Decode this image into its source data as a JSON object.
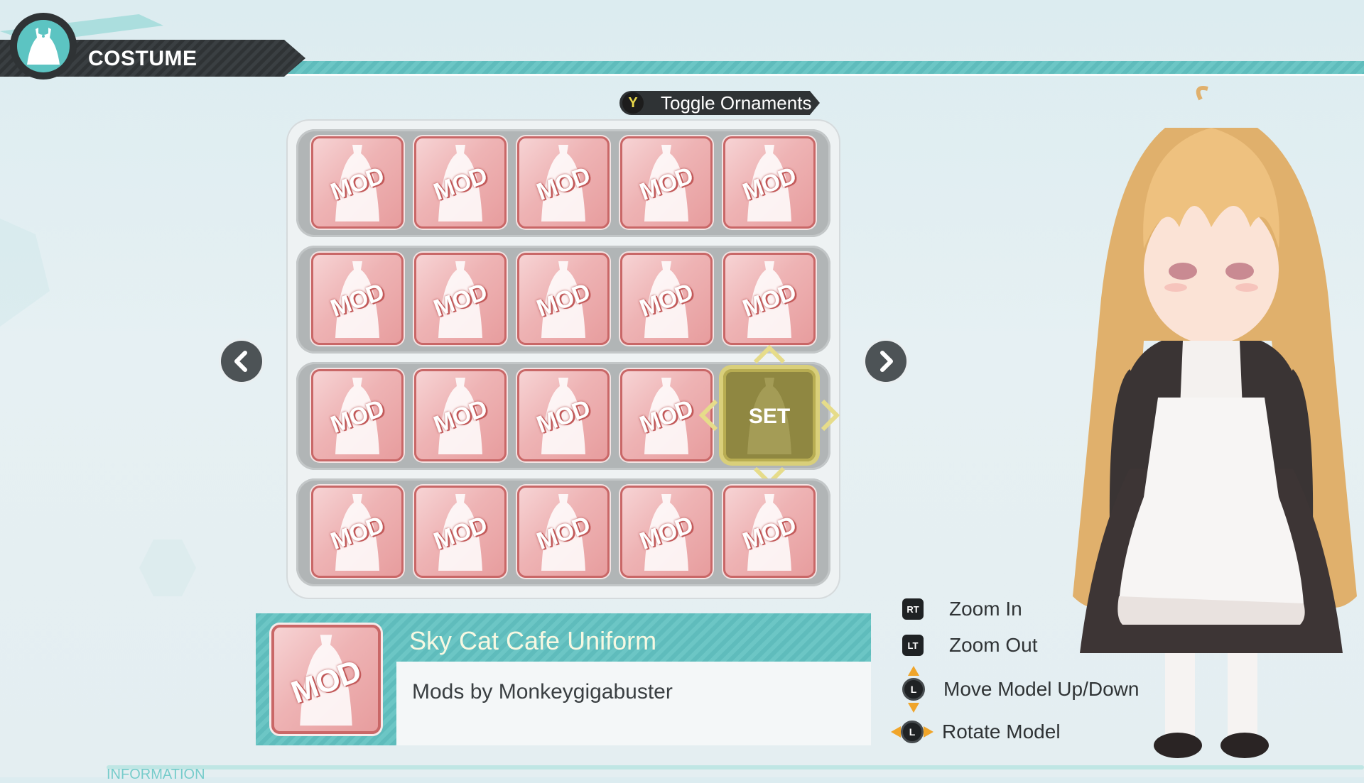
{
  "header": {
    "title": "COSTUME",
    "icon": "dress-icon"
  },
  "toggle": {
    "button": "Y",
    "label": "Toggle Ornaments"
  },
  "grid": {
    "rows": [
      [
        "MOD",
        "MOD",
        "MOD",
        "MOD",
        "MOD"
      ],
      [
        "MOD",
        "MOD",
        "MOD",
        "MOD",
        "MOD"
      ],
      [
        "MOD",
        "MOD",
        "MOD",
        "MOD",
        "SET"
      ],
      [
        "MOD",
        "MOD",
        "MOD",
        "MOD",
        "MOD"
      ]
    ],
    "selected_label": "SET"
  },
  "info": {
    "name": "Sky Cat Cafe Uniform",
    "author": "Mods by Monkeygigabuster",
    "icon_label": "MOD"
  },
  "controls": [
    {
      "button": "RT",
      "label": "Zoom In"
    },
    {
      "button": "LT",
      "label": "Zoom Out"
    },
    {
      "button": "L",
      "label": "Move Model Up/Down"
    },
    {
      "button": "L",
      "label": "Rotate Model"
    }
  ],
  "footer": {
    "tab": "INFORMATION"
  },
  "colors": {
    "accent": "#5cc4c2",
    "tile": "#eeb3b4",
    "selected": "#8f8741",
    "dark": "#2f3335"
  }
}
